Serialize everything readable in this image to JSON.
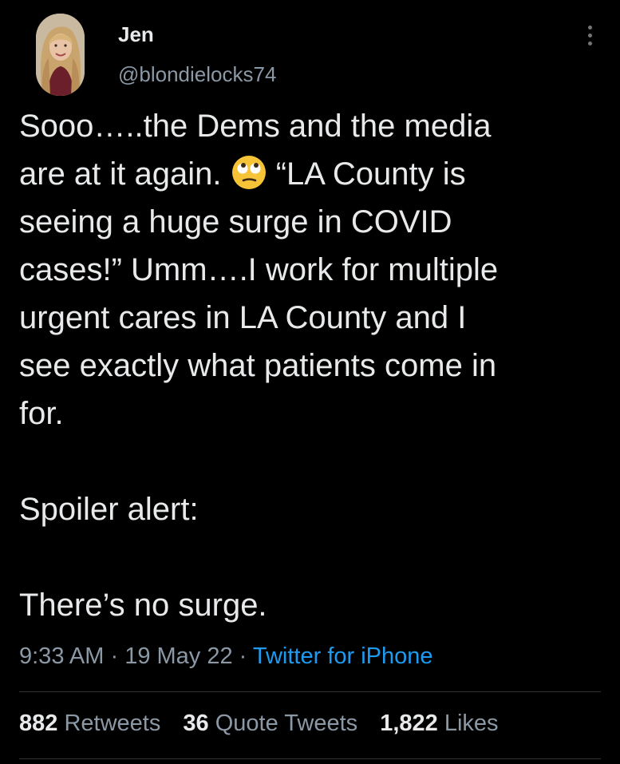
{
  "user": {
    "display_name": "Jen",
    "handle": "@blondielocks74",
    "avatar_icon": "profile-photo"
  },
  "tweet": {
    "line1": "Sooo…..the Dems and the media",
    "line2_before_emoji": "are at it again. ",
    "emoji_icon": "face-with-rolling-eyes-emoji",
    "line2_after_emoji": " “LA County is",
    "line3": "seeing a huge surge in COVID",
    "line4": "cases!” Umm….I work for multiple",
    "line5": "urgent cares in LA County and I",
    "line6": "see exactly what patients come in",
    "line7": "for.",
    "para2": "Spoiler alert:",
    "para3": "There’s no surge."
  },
  "meta": {
    "time": "9:33 AM",
    "sep1": " · ",
    "date": "19 May 22",
    "sep2": " · ",
    "source": "Twitter for iPhone"
  },
  "stats": {
    "retweets_count": "882",
    "retweets_label": "Retweets",
    "quote_count": "36",
    "quote_label": "Quote Tweets",
    "likes_count": "1,822",
    "likes_label": "Likes"
  },
  "colors": {
    "background": "#000000",
    "primary_text": "#e7e9ea",
    "secondary_text": "#8b98a5",
    "link": "#1d9bf0",
    "divider": "#2f3336"
  }
}
